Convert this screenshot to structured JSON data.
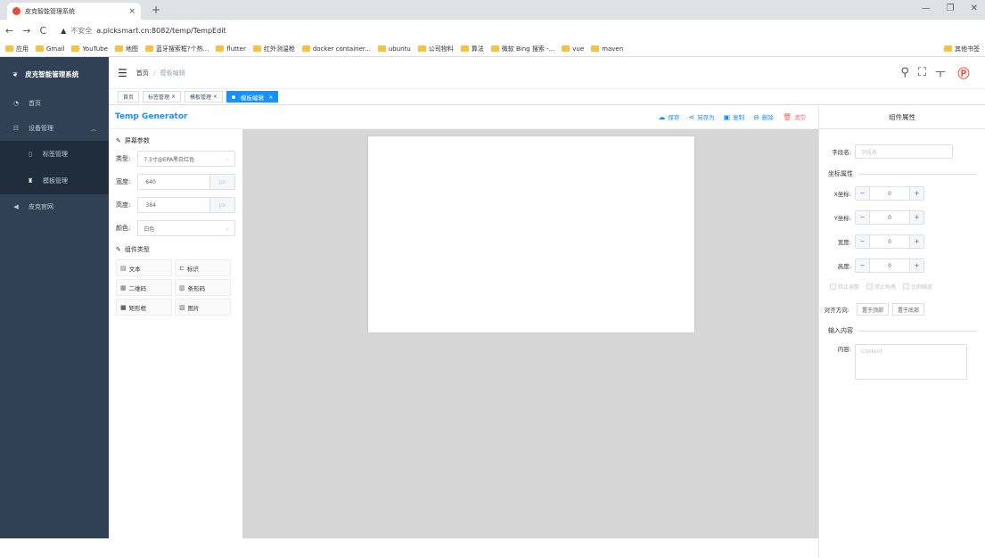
{
  "browser": {
    "tab_title": "皮克智能管理系统",
    "url": "a.plcksmart.cn:8082/temp/TempEdit",
    "security_warning": "不安全",
    "bookmarks": [
      "应用",
      "Gmail",
      "YouTube",
      "地图",
      "蓝牙搜索框?个热...",
      "flutter",
      "红外测温枪",
      "docker container...",
      "ubuntu",
      "公司物料",
      "算法",
      "微软 Bing 搜索 -...",
      "vue",
      "maven"
    ],
    "other_bookmarks": "其他书签"
  },
  "sidebar": {
    "logo": "皮克智能管理系统",
    "items": [
      {
        "label": "首页"
      },
      {
        "label": "设备管理"
      },
      {
        "label": "标签管理"
      },
      {
        "label": "模板管理"
      },
      {
        "label": "皮克官网"
      }
    ]
  },
  "header": {
    "breadcrumb_home": "首页",
    "breadcrumb_sep": "/",
    "breadcrumb_current": "模板编辑"
  },
  "tags": [
    "首页",
    "标签管理",
    "模板管理",
    "模板编辑"
  ],
  "main": {
    "title": "Temp Generator",
    "actions": [
      "保存",
      "另存为",
      "复制",
      "删除",
      "清空"
    ]
  },
  "left": {
    "screen_section": "屏幕参数",
    "type_label": "类型:",
    "type_value": "7.5寸@EPA黑白红色",
    "width_label": "宽度:",
    "width_value": "640",
    "height_label": "高度:",
    "height_value": "384",
    "unit": "px",
    "color_label": "颜色:",
    "color_value": "白色",
    "component_section": "组件类型",
    "components": [
      "文本",
      "标识",
      "二维码",
      "条形码",
      "矩形框",
      "图片"
    ]
  },
  "right": {
    "title": "组件属性",
    "field_label": "字段名:",
    "field_placeholder": "字段名",
    "coord_section": "坐标属性",
    "x_label": "X坐标:",
    "y_label": "Y坐标:",
    "w_label": "宽度:",
    "h_label": "高度:",
    "x": "0",
    "y": "0",
    "w": "0",
    "h": "0",
    "checkboxes": [
      "禁止调整",
      "禁止拖拽",
      "比例缩放"
    ],
    "align_label": "对齐方向:",
    "align_top": "置于顶部",
    "align_bottom": "置于底部",
    "input_section": "输入内容",
    "content_label": "内容:",
    "content_placeholder": "Content"
  }
}
